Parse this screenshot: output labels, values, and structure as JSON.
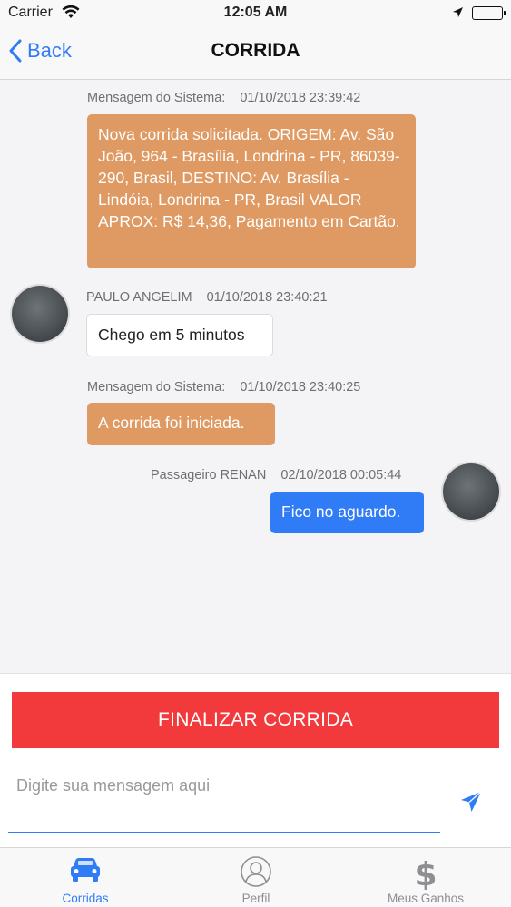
{
  "status_bar": {
    "carrier": "Carrier",
    "time": "12:05 AM"
  },
  "nav": {
    "back_label": "Back",
    "title": "CORRIDA"
  },
  "messages": [
    {
      "type": "system",
      "sender": "Mensagem do Sistema:",
      "date": "01/10/2018 23:39:42",
      "text": "Nova corrida solicitada. ORIGEM: Av. São João, 964 - Brasília, Londrina - PR, 86039-290, Brasil, DESTINO: Av. Brasília - Lindóia, Londrina - PR, Brasil VALOR APROX: R$ 14,36, Pagamento em Cartão."
    },
    {
      "type": "incoming",
      "sender": "PAULO ANGELIM",
      "date": "01/10/2018 23:40:21",
      "text": "Chego em 5 minutos"
    },
    {
      "type": "system",
      "sender": "Mensagem do Sistema:",
      "date": "01/10/2018 23:40:25",
      "text": "A corrida foi iniciada."
    },
    {
      "type": "outgoing",
      "sender": "Passageiro RENAN",
      "date": "02/10/2018 00:05:44",
      "text": "Fico no aguardo."
    }
  ],
  "actions": {
    "finish_label": "FINALIZAR CORRIDA"
  },
  "composer": {
    "placeholder": "Digite sua mensagem aqui",
    "value": ""
  },
  "tabs": [
    {
      "label": "Corridas",
      "icon": "car-icon",
      "active": true
    },
    {
      "label": "Perfil",
      "icon": "profile-icon",
      "active": false
    },
    {
      "label": "Meus Ganhos",
      "icon": "dollar-icon",
      "active": false
    }
  ],
  "colors": {
    "accent": "#2f7cf6",
    "system_bubble": "#df9a63",
    "finish_button": "#f23a3c"
  }
}
